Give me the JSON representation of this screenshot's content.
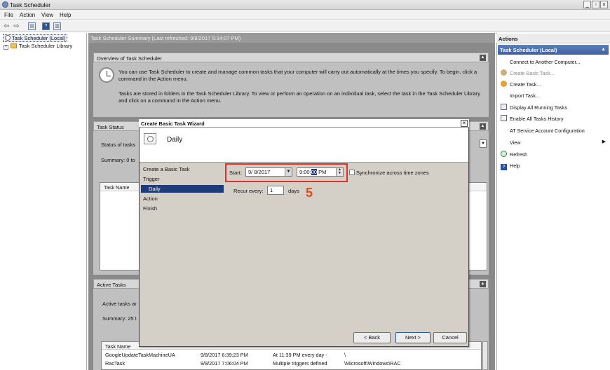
{
  "window": {
    "title": "Task Scheduler"
  },
  "menu": [
    "File",
    "Action",
    "View",
    "Help"
  ],
  "tree": {
    "root": "Task Scheduler (Local)",
    "child": "Task Scheduler Library"
  },
  "main": {
    "header": "Task Scheduler Summary (Last refreshed: 9/8/2017 6:34:07 PM)",
    "overview": {
      "title": "Overview of Task Scheduler",
      "para1": "You can use Task Scheduler to create and manage common tasks that your computer will carry out automatically at the times you specify. To begin, click a command in the Action menu.",
      "para2": "Tasks are stored in folders in the Task Scheduler Library. To view or perform an operation on an individual task, select the task in the Task Scheduler Library and click on a command in the Action menu."
    },
    "task_status": {
      "title": "Task Status",
      "status_label": "Status of tasks",
      "summary": "Summary: 0 to",
      "col_task_name": "Task Name"
    },
    "active_tasks": {
      "title": "Active Tasks",
      "label": "Active tasks ar",
      "summary": "Summary: 25 t",
      "col_task_name": "Task Name",
      "rows": [
        {
          "name": "GoogleUpdateTaskMachineUA",
          "next_run": "9/8/2017 6:39:23 PM",
          "triggers": "At 11:39 PM every day -",
          "location": "\\"
        },
        {
          "name": "RacTask",
          "next_run": "9/8/2017 7:06:04 PM",
          "triggers": "Multiple triggers defined",
          "location": "\\Microsoft\\Windows\\RAC"
        }
      ]
    }
  },
  "actions": {
    "title": "Actions",
    "subheader": "Task Scheduler (Local)",
    "items": [
      {
        "label": "Connect to Another Computer...",
        "icon": "none",
        "disabled": false
      },
      {
        "label": "Create Basic Task...",
        "icon": "create-basic-task-icon",
        "disabled": true
      },
      {
        "label": "Create Task...",
        "icon": "create-task-icon",
        "disabled": false
      },
      {
        "label": "Import Task...",
        "icon": "none",
        "disabled": false
      },
      {
        "label": "Display All Running Tasks",
        "icon": "running-tasks-icon",
        "disabled": false
      },
      {
        "label": "Enable All Tasks History",
        "icon": "history-icon",
        "disabled": false
      },
      {
        "label": "AT Service Account Configuration",
        "icon": "none",
        "disabled": false
      },
      {
        "label": "View",
        "icon": "none",
        "disabled": false
      },
      {
        "label": "Refresh",
        "icon": "refresh-icon",
        "disabled": false
      },
      {
        "label": "Help",
        "icon": "help-icon",
        "disabled": false
      }
    ]
  },
  "wizard": {
    "title": "Create Basic Task Wizard",
    "page_title": "Daily",
    "steps": [
      "Create a Basic Task",
      "Trigger",
      "Daily",
      "Action",
      "Finish"
    ],
    "selected_step": "Daily",
    "start_label": "Start:",
    "start_date": "9/  8/2017",
    "start_time_before": "9:00:",
    "start_time_selected": "00",
    "start_time_after": " PM",
    "sync_label": "Synchronize across time zones",
    "sync_checked": false,
    "recur_label": "Recur every:",
    "recur_value": "1",
    "recur_unit": "days",
    "annotation_number": "5",
    "buttons": {
      "back": "< Back",
      "next": "Next >",
      "cancel": "Cancel"
    }
  },
  "colors": {
    "highlight_box": "#e0302a",
    "selection": "#1f3b7a",
    "annotation": "#e04a14"
  }
}
